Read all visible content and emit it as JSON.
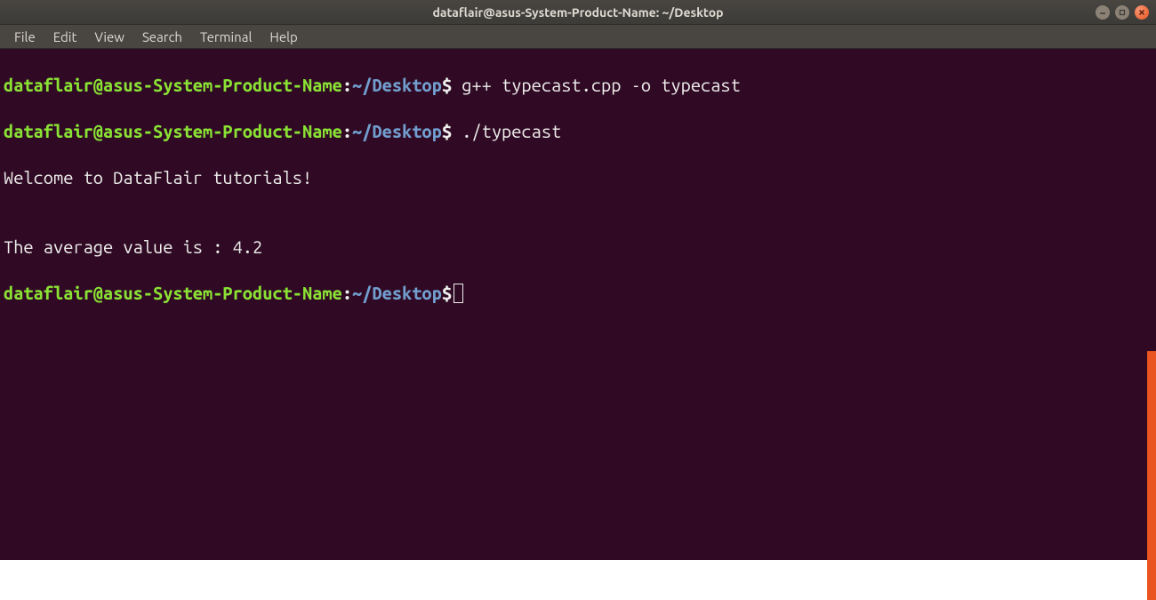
{
  "titlebar": {
    "title": "dataflair@asus-System-Product-Name: ~/Desktop"
  },
  "menubar": {
    "items": [
      {
        "label": "File"
      },
      {
        "label": "Edit"
      },
      {
        "label": "View"
      },
      {
        "label": "Search"
      },
      {
        "label": "Terminal"
      },
      {
        "label": "Help"
      }
    ]
  },
  "terminal": {
    "prompt": {
      "user": "dataflair@asus-System-Product-Name",
      "colon": ":",
      "path": "~/Desktop",
      "dollar": "$"
    },
    "lines": {
      "cmd1": " g++ typecast.cpp -o typecast",
      "cmd2": " ./typecast",
      "out1": "Welcome to DataFlair tutorials!",
      "out2": "",
      "out3": "The average value is : 4.2",
      "cmd3": " "
    }
  },
  "colors": {
    "bg": "#300a24",
    "prompt_user": "#8ae234",
    "prompt_path": "#729fcf",
    "text": "#eeeeec",
    "close": "#e95420"
  }
}
